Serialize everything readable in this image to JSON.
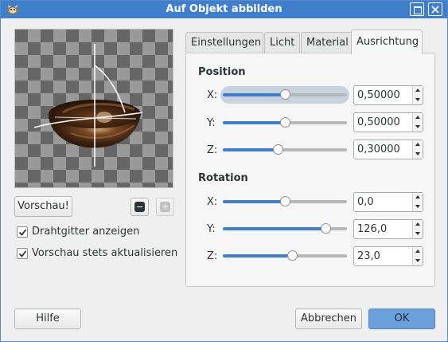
{
  "window": {
    "title": "Auf Objekt abbilden",
    "icons": {
      "app": "gimp-app-icon",
      "maximize": "maximize-icon",
      "close": "close-icon"
    }
  },
  "preview": {
    "button_label": "Vorschau!",
    "zoom_out_icon": "zoom-out-icon",
    "zoom_in_icon": "zoom-in-icon"
  },
  "options": {
    "wireframe": {
      "label": "Drahtgitter anzeigen",
      "checked": true
    },
    "autoupdate": {
      "label": "Vorschau stets aktualisieren",
      "checked": true
    }
  },
  "tabs": [
    {
      "label": "Einstellungen",
      "active": false
    },
    {
      "label": "Licht",
      "active": false
    },
    {
      "label": "Material",
      "active": false
    },
    {
      "label": "Ausrichtung",
      "active": true
    }
  ],
  "orientation": {
    "position": {
      "heading": "Position",
      "fields": [
        {
          "axis": "X:",
          "value": "0,50000",
          "fraction": 0.5
        },
        {
          "axis": "Y:",
          "value": "0,50000",
          "fraction": 0.5
        },
        {
          "axis": "Z:",
          "value": "0,30000",
          "fraction": 0.44
        }
      ]
    },
    "rotation": {
      "heading": "Rotation",
      "fields": [
        {
          "axis": "X:",
          "value": "0,0",
          "fraction": 0.5
        },
        {
          "axis": "Y:",
          "value": "126,0",
          "fraction": 0.825
        },
        {
          "axis": "Z:",
          "value": "23,0",
          "fraction": 0.56
        }
      ]
    }
  },
  "footer": {
    "help": "Hilfe",
    "cancel": "Abbrechen",
    "ok": "OK"
  },
  "colors": {
    "accent": "#3f7ecb",
    "ok_button": "#6ca0dc"
  }
}
